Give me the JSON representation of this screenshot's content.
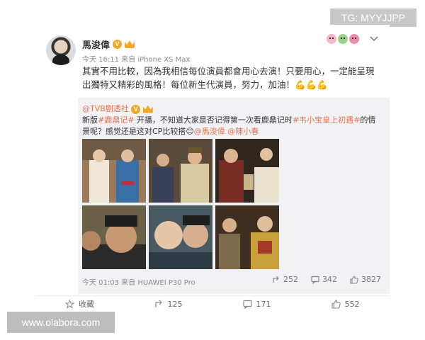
{
  "watermarks": {
    "top_right": "TG: MYYJJPP",
    "bottom_left": "www.olabora.com"
  },
  "post": {
    "username": "馬浚偉",
    "badge_letter": "V",
    "meta": "今天 16:11 来自 iPhone XS Max",
    "text": "其實不用比較，因為我相信每位演員都會用心去演！只要用心，一定能呈現出獨特又精彩的風格！每位新生代演員，努力，加油！",
    "emoji": "💪💪💪"
  },
  "repost": {
    "author": "@TVB剧透社",
    "badge_letter": "V",
    "text_part1": "新版",
    "tag1": "#鹿鼎记#",
    "text_part2": " 开播，不知道大家是否记得第一次看鹿鼎记时",
    "tag2": "#韦小宝皇上初遇#",
    "text_part3": "的情景呢？感觉还是这对CP比较搭",
    "emoji": "😊",
    "mention1": "@馬浚偉",
    "mention2": "@陳小春",
    "meta": "今天 01:03 来自 HUAWEI P30 Pro",
    "share_count": "252",
    "comment_count": "342",
    "like_count": "3827"
  },
  "actions": {
    "collect_label": "收藏",
    "share_count": "125",
    "comment_count": "171",
    "like_count": "552"
  },
  "colors": {
    "link": "#eb7350",
    "badge": "#f5a623",
    "repost_bg": "#f2f2f5"
  }
}
